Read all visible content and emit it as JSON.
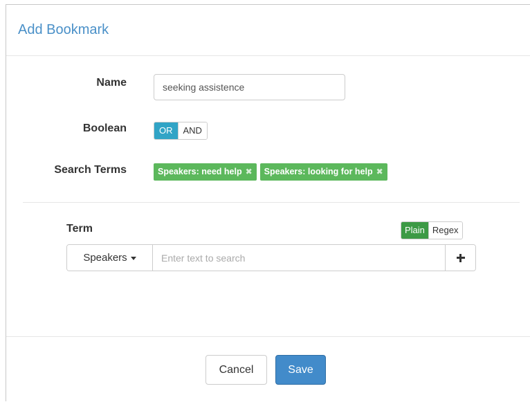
{
  "modal": {
    "title": "Add Bookmark"
  },
  "form": {
    "name_label": "Name",
    "name_value": "seeking assistence",
    "boolean_label": "Boolean",
    "boolean_options": [
      "OR",
      "AND"
    ],
    "boolean_selected": "OR",
    "search_terms_label": "Search Terms",
    "search_terms": [
      {
        "label": "Speakers: need help",
        "remove_icon": "close-icon"
      },
      {
        "label": "Speakers: looking for help",
        "remove_icon": "close-icon"
      }
    ]
  },
  "term_builder": {
    "term_label": "Term",
    "mode_options": [
      "Plain",
      "Regex"
    ],
    "mode_selected": "Plain",
    "field_dropdown": "Speakers",
    "search_placeholder": "Enter text to search",
    "add_icon": "plus-icon"
  },
  "footer": {
    "cancel_label": "Cancel",
    "save_label": "Save"
  },
  "colors": {
    "title": "#4a90c8",
    "boolean_active": "#31a4c6",
    "term_badge": "#5cb85c",
    "plain_active": "#3c9a45",
    "save_button": "#428bca"
  }
}
